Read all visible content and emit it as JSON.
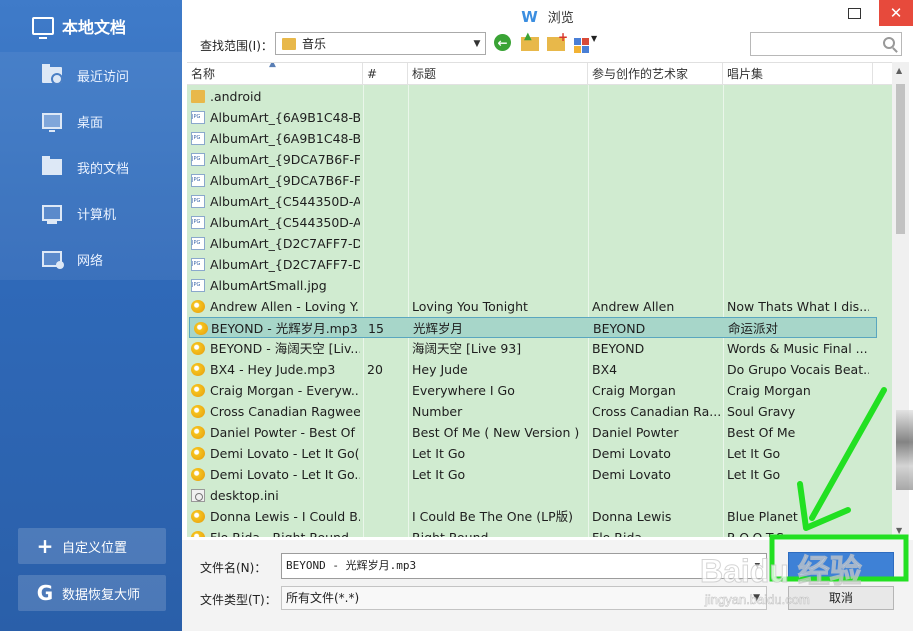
{
  "sidebar": {
    "title": "本地文档",
    "items": [
      {
        "label": "最近访问",
        "icon": "recent-folder-icon"
      },
      {
        "label": "桌面",
        "icon": "desktop-icon"
      },
      {
        "label": "我的文档",
        "icon": "documents-folder-icon"
      },
      {
        "label": "计算机",
        "icon": "computer-icon"
      },
      {
        "label": "网络",
        "icon": "network-icon"
      }
    ],
    "custom_location": "自定义位置",
    "recovery_master": "数据恢复大师"
  },
  "window": {
    "title": "浏览",
    "logo_letter": "W",
    "close_glyph": "✕"
  },
  "toolbar": {
    "look_in_label": "查找范围(I)：",
    "look_in_value": "音乐",
    "search_placeholder": ""
  },
  "columns": {
    "name": "名称",
    "number": "#",
    "title": "标题",
    "artist": "参与创作的艺术家",
    "album": "唱片集"
  },
  "files": [
    {
      "name": ".android",
      "num": "",
      "title": "",
      "artist": "",
      "album": "",
      "icon": "folder"
    },
    {
      "name": "AlbumArt_{6A9B1C48-B...",
      "num": "",
      "title": "",
      "artist": "",
      "album": "",
      "icon": "jpg"
    },
    {
      "name": "AlbumArt_{6A9B1C48-B...",
      "num": "",
      "title": "",
      "artist": "",
      "album": "",
      "icon": "jpg"
    },
    {
      "name": "AlbumArt_{9DCA7B6F-FF...",
      "num": "",
      "title": "",
      "artist": "",
      "album": "",
      "icon": "jpg"
    },
    {
      "name": "AlbumArt_{9DCA7B6F-FF...",
      "num": "",
      "title": "",
      "artist": "",
      "album": "",
      "icon": "jpg"
    },
    {
      "name": "AlbumArt_{C544350D-AF...",
      "num": "",
      "title": "",
      "artist": "",
      "album": "",
      "icon": "jpg"
    },
    {
      "name": "AlbumArt_{C544350D-AF...",
      "num": "",
      "title": "",
      "artist": "",
      "album": "",
      "icon": "jpg"
    },
    {
      "name": "AlbumArt_{D2C7AFF7-D...",
      "num": "",
      "title": "",
      "artist": "",
      "album": "",
      "icon": "jpg"
    },
    {
      "name": "AlbumArt_{D2C7AFF7-D...",
      "num": "",
      "title": "",
      "artist": "",
      "album": "",
      "icon": "jpg"
    },
    {
      "name": "AlbumArtSmall.jpg",
      "num": "",
      "title": "",
      "artist": "",
      "album": "",
      "icon": "jpg"
    },
    {
      "name": "Andrew Allen - Loving Y...",
      "num": "",
      "title": "Loving You Tonight",
      "artist": "Andrew Allen",
      "album": "Now Thats What I dis...",
      "icon": "mp3"
    },
    {
      "name": "BEYOND - 光辉岁月.mp3",
      "num": "15",
      "title": "光辉岁月",
      "artist": "BEYOND",
      "album": "命运派对",
      "icon": "mp3",
      "selected": true
    },
    {
      "name": "BEYOND - 海阔天空 [Liv...",
      "num": "",
      "title": "海阔天空 [Live 93]",
      "artist": "BEYOND",
      "album": "Words & Music Final ...",
      "icon": "mp3"
    },
    {
      "name": "BX4 - Hey Jude.mp3",
      "num": "20",
      "title": "Hey Jude",
      "artist": "BX4",
      "album": "Do Grupo Vocais Beat...",
      "icon": "mp3"
    },
    {
      "name": "Craig Morgan - Everyw...",
      "num": "",
      "title": "Everywhere I Go",
      "artist": "Craig Morgan",
      "album": "Craig Morgan",
      "icon": "mp3"
    },
    {
      "name": "Cross Canadian Ragwee...",
      "num": "",
      "title": "Number",
      "artist": "Cross Canadian Ra...",
      "album": "Soul Gravy",
      "icon": "mp3"
    },
    {
      "name": "Daniel Powter - Best Of ...",
      "num": "",
      "title": "Best Of Me ( New Version )",
      "artist": "Daniel Powter",
      "album": "Best Of Me",
      "icon": "mp3"
    },
    {
      "name": "Demi Lovato - Let It Go(...",
      "num": "",
      "title": "Let It Go",
      "artist": "Demi Lovato",
      "album": "Let It Go",
      "icon": "mp3"
    },
    {
      "name": "Demi Lovato - Let It Go....",
      "num": "",
      "title": "Let It Go",
      "artist": "Demi Lovato",
      "album": "Let It Go",
      "icon": "mp3"
    },
    {
      "name": "desktop.ini",
      "num": "",
      "title": "",
      "artist": "",
      "album": "",
      "icon": "ini"
    },
    {
      "name": "Donna Lewis - I Could B...",
      "num": "",
      "title": "I Could Be The One (LP版)",
      "artist": "Donna Lewis",
      "album": "Blue Planet",
      "icon": "mp3"
    },
    {
      "name": "Flo Rida - Right Round",
      "num": "",
      "title": "Right Round",
      "artist": "Flo Rida",
      "album": "R.O.O.T.S.",
      "icon": "mp3"
    }
  ],
  "bottom": {
    "filename_label": "文件名(N)：",
    "filename_value": "BEYOND - 光辉岁月.mp3",
    "filetype_label": "文件类型(T)：",
    "filetype_value": "所有文件(*.*)",
    "open_label": "",
    "cancel_label": "取消"
  },
  "watermark": {
    "brand": "Baidu 经验",
    "url": "jingyan.baidu.com"
  },
  "colors": {
    "sidebar": "#2f69b8",
    "list_bg": "#d0ebd0",
    "selected_row": "#a7d6c9",
    "annotation_green": "#22e022",
    "close_button": "#e74a3c"
  }
}
